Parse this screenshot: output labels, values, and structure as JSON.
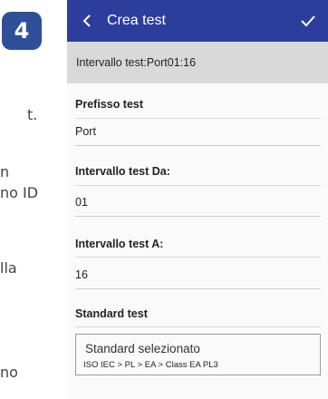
{
  "left_doc": {
    "step_number": "4",
    "fragments": [
      "t.",
      "n",
      "no ID",
      "lla",
      "no"
    ]
  },
  "appbar": {
    "title": "Crea test",
    "back_icon": "chevron-left-icon",
    "confirm_icon": "check-icon"
  },
  "range_bar": {
    "text": "Intervallo test:Port01:16"
  },
  "form": {
    "prefix_label": "Prefisso test",
    "prefix_value": "Port",
    "from_label": "Intervallo test Da:",
    "from_value": "01",
    "to_label": "Intervallo test A:",
    "to_value": "16",
    "standard_label": "Standard test",
    "standard_selected_label": "Standard selezionato",
    "standard_path": "ISO IEC > PL > EA > Class EA PL3"
  },
  "colors": {
    "appbar": "#2d3d9b",
    "badge": "#2f4f98",
    "range_bar": "#d9d9d9"
  }
}
